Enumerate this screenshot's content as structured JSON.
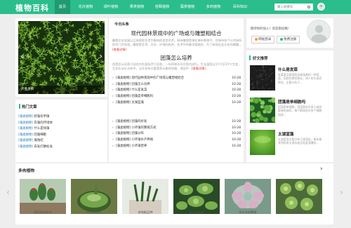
{
  "header": {
    "logo": "植物百科",
    "nav": [
      "首页",
      "花卉植物",
      "观叶植物",
      "果类植物",
      "苔藓植物",
      "藻类植物",
      "多肉植物",
      "百科知识"
    ],
    "active_index": 0,
    "search_placeholder": "输入关键词"
  },
  "slider": {
    "caption": "大金发藓",
    "prev": "‹",
    "next": "›"
  },
  "hot": {
    "title": "热门文章",
    "items": [
      {
        "tag": "[藻类植物]",
        "text": "虾藻有甲藻"
      },
      {
        "tag": "[藻类植物]",
        "text": "衣藻的环境体"
      },
      {
        "tag": "[藻类植物]",
        "text": "什么是绿藻"
      },
      {
        "tag": "[藻类植物]",
        "text": "团藻细胞"
      },
      {
        "tag": "[藻类植物]",
        "text": "藻蚀结"
      },
      {
        "tag": "[藻类植物]",
        "text": "白发灯鳞标准"
      }
    ]
  },
  "headline": {
    "today": "今日头条",
    "title1": "现代园林景观中的广场或与雕塑相结合",
    "summary1": "雕塑文化发展以立体视觉艺术为载体的造型艺术。城市雕塑是指在城市景观中，在城市各个公共场所的专门空间里。雕塑是艺术、文化、环境的结合，艺术中的美学相融合，为了体现社会文化的精髓...",
    "more1": "[查看详情]",
    "title2": "团藻怎么培养",
    "summary2": "团藻怎么培养只适合在恒温条件下培育，一年四季均可在室内进行。生长温度以15℃至25℃为宜，生长在淡水水体中，以在含有丰富营养元素的池塘、湖泊中...",
    "more2": "[查看详情]",
    "news_a": [
      {
        "text": "[藻类植物] 现代园林景观中的广场或与雕塑相结合",
        "date": "10-28"
      },
      {
        "text": "[藻类植物] 团藻怎么培养",
        "date": "10-28"
      },
      {
        "text": "[藻类植物] 什么是发菜",
        "date": "10-28"
      },
      {
        "text": "[藻类植物] 团藻是单细胞吗",
        "date": "10-28"
      },
      {
        "text": "[藻类植物] 太湖蓝藻",
        "date": "10-28"
      }
    ],
    "news_b": [
      {
        "text": "[藻类植物] 团藻的好处",
        "date": "10-28"
      },
      {
        "text": "[藻类植物] 小环藻的繁殖方式",
        "date": "10-28"
      },
      {
        "text": "[藻类植物] 团藻分布",
        "date": "10-28"
      },
      {
        "text": "[藻类植物] 小环藻水产养殖",
        "date": "10-28"
      },
      {
        "text": "[藻类植物] 小环藻营养",
        "date": "10-28"
      }
    ]
  },
  "user": {
    "welcome": "期待你的加入！欢迎来投稿！",
    "login": "网站登录",
    "register": "免费注册"
  },
  "good": {
    "title": "好文推荐",
    "items": [
      {
        "title": "什么是发菜",
        "desc": "发菜是念珠藻科念珠藻属的一种藻类，因其色黑而细长，如人的头发而得名，主要分布于..."
      },
      {
        "title": "团藻是单细胞吗",
        "desc": "团藻是单细胞，团藻是由许多小球形群体构成的，每个群体由许多个细胞组成..."
      },
      {
        "title": "太湖蓝藻",
        "desc": "太湖蓝藻主要分布于湖湾处，每年春季到秋季太湖水面呈现蓝藻爆发..."
      }
    ]
  },
  "bottom": {
    "title": "多肉植物",
    "items": [
      "观光多肉花卉",
      "苍角殿播种",
      "苍角殿品种",
      "观光拇多肉",
      "观光多肉繁殖",
      "有枝球有毒"
    ]
  }
}
